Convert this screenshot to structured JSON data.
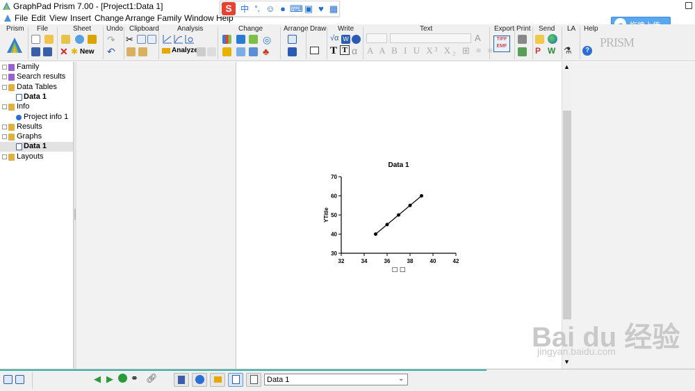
{
  "window": {
    "title": "GraphPad Prism 7.00 - [Project1:Data 1]"
  },
  "menu": [
    "File",
    "Edit",
    "View",
    "Insert",
    "Change",
    "Arrange",
    "Family",
    "Window",
    "Help"
  ],
  "ime": {
    "lang": "中",
    "punct": "°,"
  },
  "upload_button": {
    "label": "拖拽上传"
  },
  "ribbon": {
    "groups": [
      "Prism",
      "File",
      "Sheet",
      "Undo",
      "Clipboard",
      "Analysis",
      "Change",
      "Arrange",
      "Draw",
      "Write",
      "Text",
      "Export",
      "Print",
      "Send",
      "LA",
      "Help"
    ],
    "sheet_new_label": "New",
    "analyze_label": "Analyze",
    "prism_logo": "PRISM"
  },
  "navigator": {
    "items": [
      {
        "label": "Family",
        "bold": false,
        "indent": 0
      },
      {
        "label": "Search results",
        "bold": false,
        "indent": 0
      },
      {
        "label": "Data Tables",
        "bold": false,
        "indent": 0
      },
      {
        "label": "Data 1",
        "bold": true,
        "indent": 1
      },
      {
        "label": "Info",
        "bold": false,
        "indent": 0
      },
      {
        "label": "Project info 1",
        "bold": false,
        "indent": 1
      },
      {
        "label": "Results",
        "bold": false,
        "indent": 0
      },
      {
        "label": "Graphs",
        "bold": false,
        "indent": 0
      },
      {
        "label": "Data 1",
        "bold": true,
        "indent": 1,
        "selected": true
      },
      {
        "label": "Layouts",
        "bold": false,
        "indent": 0
      }
    ]
  },
  "graph": {
    "title": "Data 1",
    "ylabel": "YTitle",
    "xlabel": "□ □"
  },
  "chart_data": {
    "type": "line",
    "title": "Data 1",
    "xlabel": "□ □",
    "ylabel": "YTitle",
    "xlim": [
      32,
      42
    ],
    "ylim": [
      30,
      70
    ],
    "xticks": [
      32,
      34,
      36,
      38,
      40,
      42
    ],
    "yticks": [
      30,
      40,
      50,
      60,
      70
    ],
    "x": [
      35,
      36,
      37,
      38,
      39
    ],
    "y": [
      40,
      45,
      50,
      55,
      60
    ]
  },
  "bottom": {
    "sheet_selector": "Data 1"
  },
  "watermark": {
    "logo": "Bai du 经验",
    "url": "jingyan.baidu.com"
  }
}
